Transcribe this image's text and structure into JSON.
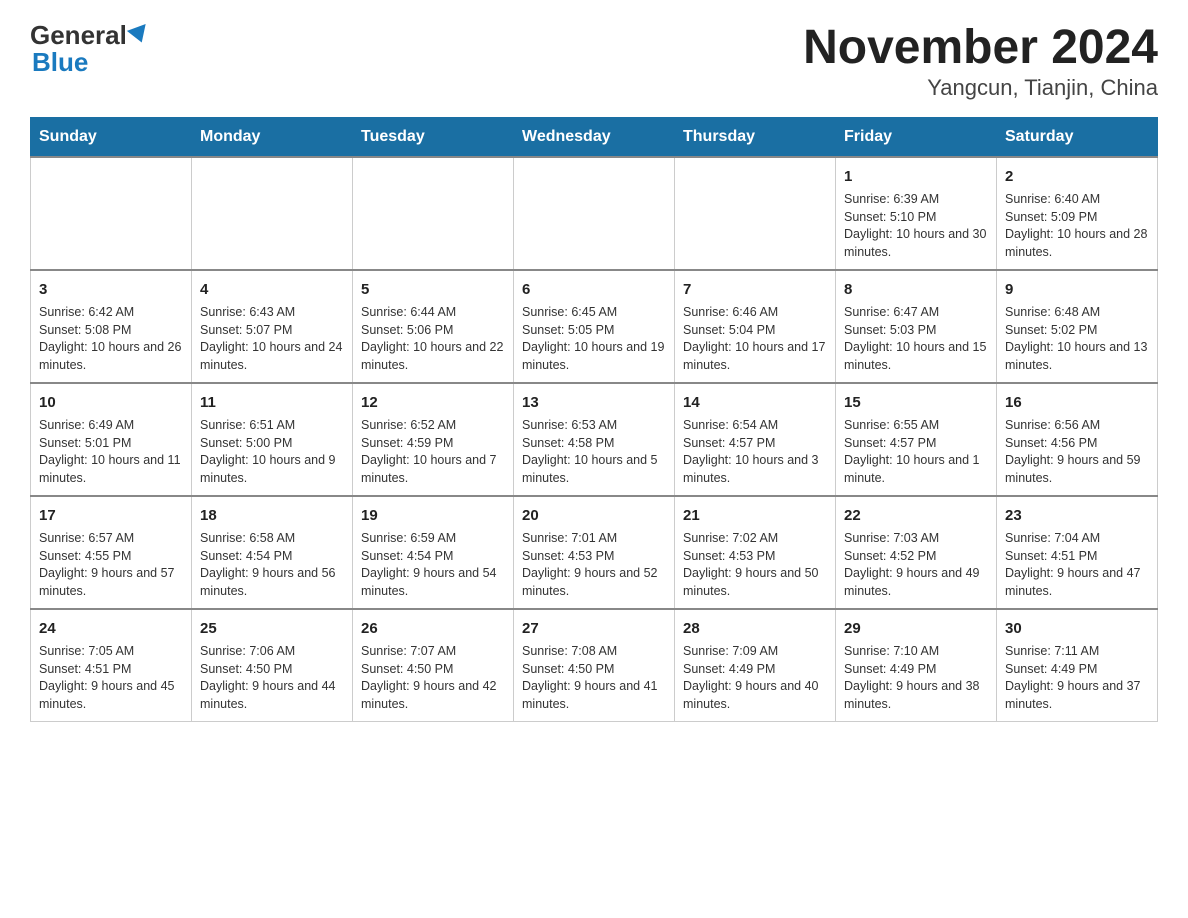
{
  "header": {
    "logo_general": "General",
    "logo_blue": "Blue",
    "title": "November 2024",
    "subtitle": "Yangcun, Tianjin, China"
  },
  "days_of_week": [
    "Sunday",
    "Monday",
    "Tuesday",
    "Wednesday",
    "Thursday",
    "Friday",
    "Saturday"
  ],
  "weeks": [
    [
      {
        "day": "",
        "info": ""
      },
      {
        "day": "",
        "info": ""
      },
      {
        "day": "",
        "info": ""
      },
      {
        "day": "",
        "info": ""
      },
      {
        "day": "",
        "info": ""
      },
      {
        "day": "1",
        "info": "Sunrise: 6:39 AM\nSunset: 5:10 PM\nDaylight: 10 hours and 30 minutes."
      },
      {
        "day": "2",
        "info": "Sunrise: 6:40 AM\nSunset: 5:09 PM\nDaylight: 10 hours and 28 minutes."
      }
    ],
    [
      {
        "day": "3",
        "info": "Sunrise: 6:42 AM\nSunset: 5:08 PM\nDaylight: 10 hours and 26 minutes."
      },
      {
        "day": "4",
        "info": "Sunrise: 6:43 AM\nSunset: 5:07 PM\nDaylight: 10 hours and 24 minutes."
      },
      {
        "day": "5",
        "info": "Sunrise: 6:44 AM\nSunset: 5:06 PM\nDaylight: 10 hours and 22 minutes."
      },
      {
        "day": "6",
        "info": "Sunrise: 6:45 AM\nSunset: 5:05 PM\nDaylight: 10 hours and 19 minutes."
      },
      {
        "day": "7",
        "info": "Sunrise: 6:46 AM\nSunset: 5:04 PM\nDaylight: 10 hours and 17 minutes."
      },
      {
        "day": "8",
        "info": "Sunrise: 6:47 AM\nSunset: 5:03 PM\nDaylight: 10 hours and 15 minutes."
      },
      {
        "day": "9",
        "info": "Sunrise: 6:48 AM\nSunset: 5:02 PM\nDaylight: 10 hours and 13 minutes."
      }
    ],
    [
      {
        "day": "10",
        "info": "Sunrise: 6:49 AM\nSunset: 5:01 PM\nDaylight: 10 hours and 11 minutes."
      },
      {
        "day": "11",
        "info": "Sunrise: 6:51 AM\nSunset: 5:00 PM\nDaylight: 10 hours and 9 minutes."
      },
      {
        "day": "12",
        "info": "Sunrise: 6:52 AM\nSunset: 4:59 PM\nDaylight: 10 hours and 7 minutes."
      },
      {
        "day": "13",
        "info": "Sunrise: 6:53 AM\nSunset: 4:58 PM\nDaylight: 10 hours and 5 minutes."
      },
      {
        "day": "14",
        "info": "Sunrise: 6:54 AM\nSunset: 4:57 PM\nDaylight: 10 hours and 3 minutes."
      },
      {
        "day": "15",
        "info": "Sunrise: 6:55 AM\nSunset: 4:57 PM\nDaylight: 10 hours and 1 minute."
      },
      {
        "day": "16",
        "info": "Sunrise: 6:56 AM\nSunset: 4:56 PM\nDaylight: 9 hours and 59 minutes."
      }
    ],
    [
      {
        "day": "17",
        "info": "Sunrise: 6:57 AM\nSunset: 4:55 PM\nDaylight: 9 hours and 57 minutes."
      },
      {
        "day": "18",
        "info": "Sunrise: 6:58 AM\nSunset: 4:54 PM\nDaylight: 9 hours and 56 minutes."
      },
      {
        "day": "19",
        "info": "Sunrise: 6:59 AM\nSunset: 4:54 PM\nDaylight: 9 hours and 54 minutes."
      },
      {
        "day": "20",
        "info": "Sunrise: 7:01 AM\nSunset: 4:53 PM\nDaylight: 9 hours and 52 minutes."
      },
      {
        "day": "21",
        "info": "Sunrise: 7:02 AM\nSunset: 4:53 PM\nDaylight: 9 hours and 50 minutes."
      },
      {
        "day": "22",
        "info": "Sunrise: 7:03 AM\nSunset: 4:52 PM\nDaylight: 9 hours and 49 minutes."
      },
      {
        "day": "23",
        "info": "Sunrise: 7:04 AM\nSunset: 4:51 PM\nDaylight: 9 hours and 47 minutes."
      }
    ],
    [
      {
        "day": "24",
        "info": "Sunrise: 7:05 AM\nSunset: 4:51 PM\nDaylight: 9 hours and 45 minutes."
      },
      {
        "day": "25",
        "info": "Sunrise: 7:06 AM\nSunset: 4:50 PM\nDaylight: 9 hours and 44 minutes."
      },
      {
        "day": "26",
        "info": "Sunrise: 7:07 AM\nSunset: 4:50 PM\nDaylight: 9 hours and 42 minutes."
      },
      {
        "day": "27",
        "info": "Sunrise: 7:08 AM\nSunset: 4:50 PM\nDaylight: 9 hours and 41 minutes."
      },
      {
        "day": "28",
        "info": "Sunrise: 7:09 AM\nSunset: 4:49 PM\nDaylight: 9 hours and 40 minutes."
      },
      {
        "day": "29",
        "info": "Sunrise: 7:10 AM\nSunset: 4:49 PM\nDaylight: 9 hours and 38 minutes."
      },
      {
        "day": "30",
        "info": "Sunrise: 7:11 AM\nSunset: 4:49 PM\nDaylight: 9 hours and 37 minutes."
      }
    ]
  ]
}
